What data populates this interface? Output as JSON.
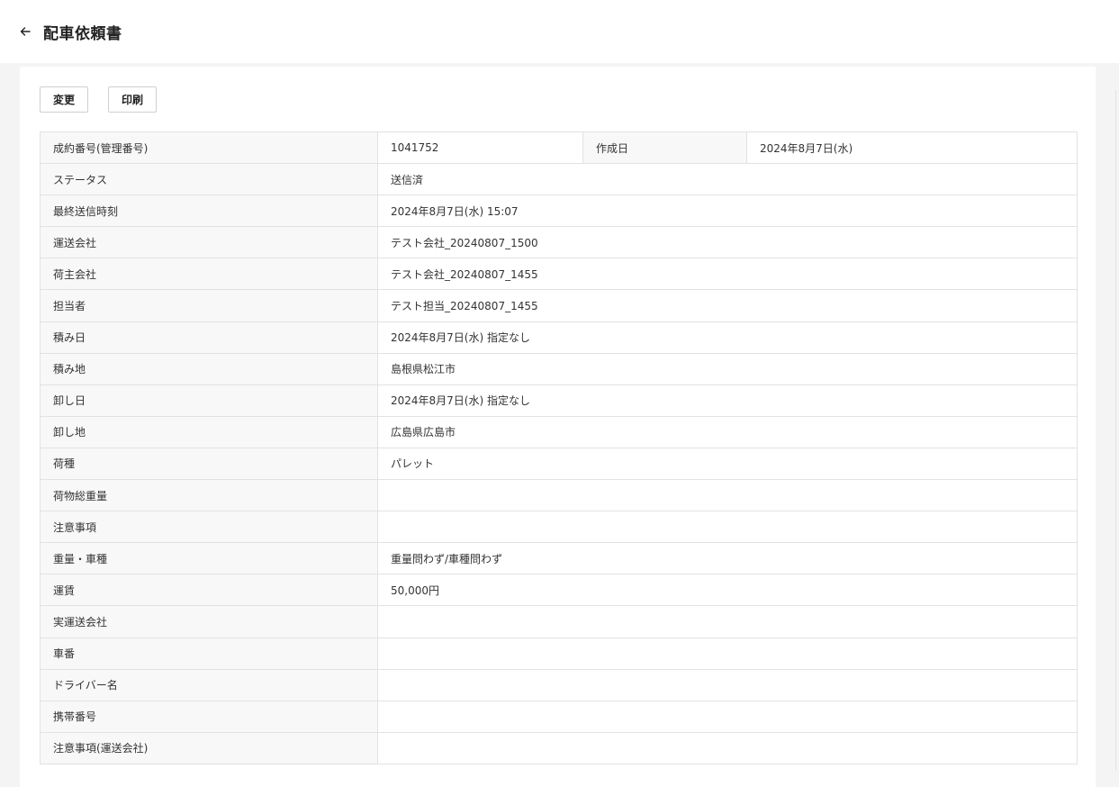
{
  "header": {
    "title": "配車依頼書",
    "back_icon": "arrow-left-icon"
  },
  "toolbar": {
    "change_label": "変更",
    "print_label": "印刷"
  },
  "table": {
    "first_row": {
      "label": "成約番号(管理番号)",
      "value": "1041752",
      "label2": "作成日",
      "value2": "2024年8月7日(水)"
    },
    "rows": [
      {
        "label": "ステータス",
        "value": "送信済"
      },
      {
        "label": "最終送信時刻",
        "value": "2024年8月7日(水) 15:07"
      },
      {
        "label": "運送会社",
        "value": "テスト会社_20240807_1500"
      },
      {
        "label": "荷主会社",
        "value": "テスト会社_20240807_1455"
      },
      {
        "label": "担当者",
        "value": "テスト担当_20240807_1455"
      },
      {
        "label": "積み日",
        "value": "2024年8月7日(水) 指定なし"
      },
      {
        "label": "積み地",
        "value": "島根県松江市"
      },
      {
        "label": "卸し日",
        "value": "2024年8月7日(水) 指定なし"
      },
      {
        "label": "卸し地",
        "value": "広島県広島市"
      },
      {
        "label": "荷種",
        "value": "パレット"
      },
      {
        "label": "荷物総重量",
        "value": ""
      },
      {
        "label": "注意事項",
        "value": ""
      },
      {
        "label": "重量・車種",
        "value": "重量問わず/車種問わず"
      },
      {
        "label": "運賃",
        "value": "50,000円"
      },
      {
        "label": "実運送会社",
        "value": ""
      },
      {
        "label": "車番",
        "value": ""
      },
      {
        "label": "ドライバー名",
        "value": ""
      },
      {
        "label": "携帯番号",
        "value": ""
      },
      {
        "label": "注意事項(運送会社)",
        "value": ""
      }
    ]
  }
}
